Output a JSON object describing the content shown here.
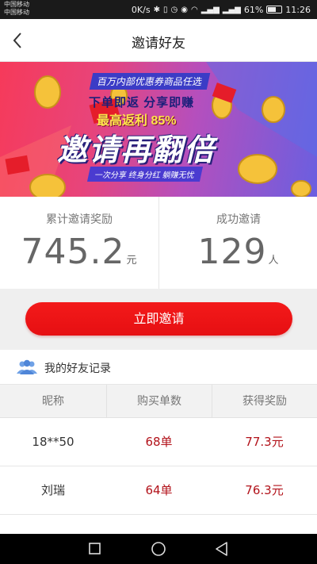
{
  "status_bar": {
    "carriers": [
      "中国移动",
      "中国移动"
    ],
    "speed": "0K/s",
    "battery_percent": "61%",
    "battery_level": 0.61,
    "time": "11:26"
  },
  "header": {
    "title": "邀请好友",
    "back_icon": "chevron-left-icon"
  },
  "banner": {
    "tag": "百万内部优惠券商品任选",
    "line1": "下单即返 分享即赚",
    "line2": "最高返利 85%",
    "headline": "邀请再翻倍",
    "sub": "一次分享 终身分红 躺赚无忧"
  },
  "stats": {
    "reward_label": "累计邀请奖励",
    "reward_value": "745.2",
    "reward_unit": "元",
    "invites_label": "成功邀请",
    "invites_value": "129",
    "invites_unit": "人"
  },
  "invite_button": {
    "label": "立即邀请",
    "color": "#ec1515"
  },
  "section": {
    "title": "我的好友记录",
    "icon": "users-icon",
    "icon_color": "#6fa1e6"
  },
  "table": {
    "columns": [
      "昵称",
      "购买单数",
      "获得奖励"
    ],
    "rows": [
      {
        "nickname": "18**50",
        "orders": "68单",
        "reward": "77.3元"
      },
      {
        "nickname": "刘瑞",
        "orders": "64单",
        "reward": "76.3元"
      },
      {
        "nickname": "",
        "orders": "",
        "reward": ""
      }
    ]
  },
  "nav_bar": {
    "buttons": [
      "recent-apps-icon",
      "home-icon",
      "back-triangle-icon"
    ]
  }
}
